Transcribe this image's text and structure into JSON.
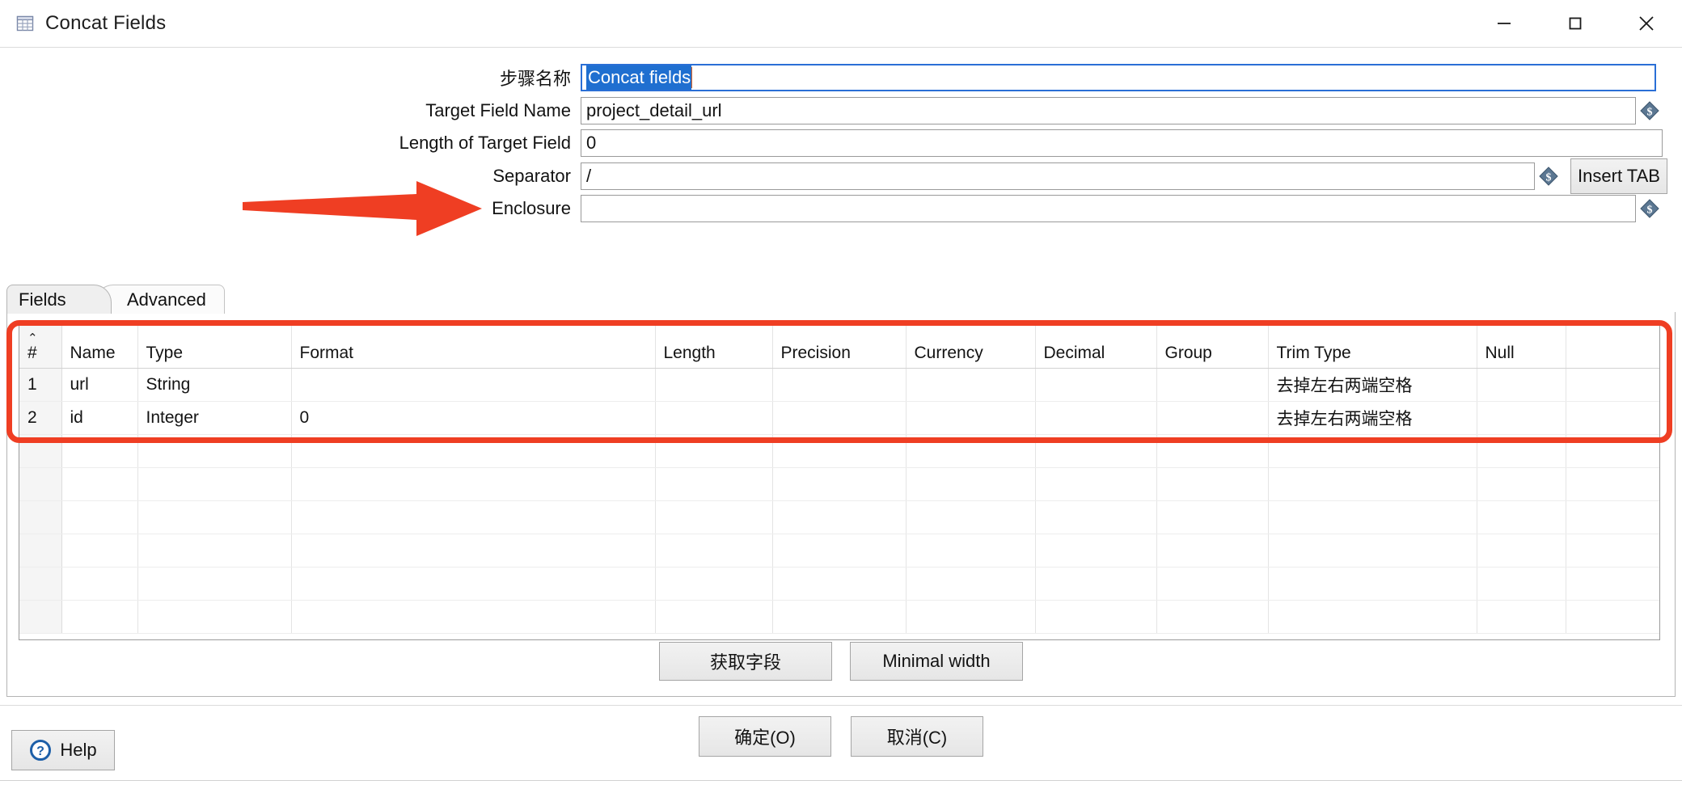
{
  "window": {
    "title": "Concat Fields",
    "icon": "grid-icon",
    "controls": {
      "minimize": "minimize-icon",
      "maximize": "maximize-icon",
      "close": "close-icon"
    }
  },
  "form": {
    "step_name": {
      "label": "步骤名称",
      "value": "Concat fields",
      "selected": true,
      "focused": true
    },
    "target_field_name": {
      "label": "Target Field Name",
      "value": "project_detail_url",
      "variable_icon": "dollar-diamond-icon"
    },
    "length_of_target_field": {
      "label": "Length of Target Field",
      "value": "0"
    },
    "separator": {
      "label": "Separator",
      "value": "/",
      "variable_icon": "dollar-diamond-icon",
      "insert_tab_button": "Insert TAB"
    },
    "enclosure": {
      "label": "Enclosure",
      "value": "",
      "variable_icon": "dollar-diamond-icon"
    }
  },
  "tabs": [
    {
      "label": "Fields",
      "active": true
    },
    {
      "label": "Advanced",
      "active": false
    }
  ],
  "table": {
    "sort_indicator": "⌃",
    "columns": [
      "#",
      "Name",
      "Type",
      "Format",
      "Length",
      "Precision",
      "Currency",
      "Decimal",
      "Group",
      "Trim Type",
      "Null",
      ""
    ],
    "rows": [
      {
        "num": "1",
        "name": "url",
        "type": "String",
        "format": "",
        "length": "",
        "precision": "",
        "currency": "",
        "decimal": "",
        "group": "",
        "trim_type": "去掉左右两端空格",
        "null": "",
        "extra": ""
      },
      {
        "num": "2",
        "name": "id",
        "type": "Integer",
        "format": "0",
        "length": "",
        "precision": "",
        "currency": "",
        "decimal": "",
        "group": "",
        "trim_type": "去掉左右两端空格",
        "null": "",
        "extra": ""
      }
    ],
    "empty_row_count": 6
  },
  "panel_buttons": {
    "get_fields": "获取字段",
    "minimal_width": "Minimal width"
  },
  "dialog_buttons": {
    "ok": "确定(O)",
    "cancel": "取消(C)"
  },
  "help": {
    "label": "Help",
    "icon": "question-circle-icon"
  },
  "annotations": {
    "arrow": {
      "name": "red-arrow-annotation",
      "color": "#ef3e23",
      "points_to": "Separator"
    },
    "highlight_box": {
      "name": "red-highlight-box",
      "color": "#ef3e23",
      "surrounds": "fields-table-rows"
    }
  },
  "colors": {
    "accent": "#2a6fd6",
    "selection": "#1f6fd0",
    "annotation": "#ef3e23",
    "caret": "#e06020"
  }
}
